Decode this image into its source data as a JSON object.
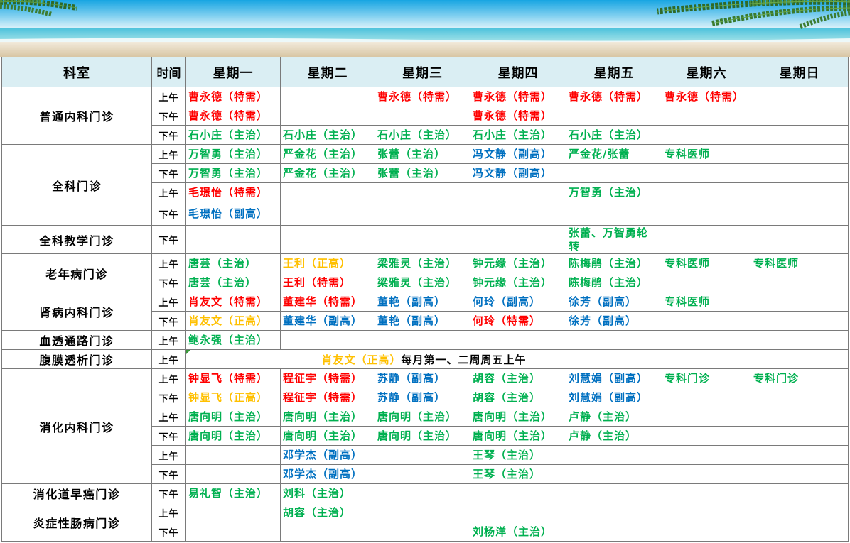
{
  "header": {
    "dept": "科室",
    "time": "时间",
    "days": [
      "星期一",
      "星期二",
      "星期三",
      "星期四",
      "星期五",
      "星期六",
      "星期日"
    ]
  },
  "header_background": "#daeef3",
  "palette": {
    "red": "#ff0000",
    "green": "#00b050",
    "blue": "#0070c0",
    "orange": "#ffc000",
    "black": "#000000"
  },
  "departments": [
    {
      "name": "普通内科门诊",
      "slots": [
        {
          "time": "上午",
          "cells": [
            {
              "text": "曹永德（特需）",
              "color": "red"
            },
            null,
            {
              "text": "曹永德（特需）",
              "color": "red"
            },
            {
              "text": "曹永德（特需）",
              "color": "red"
            },
            {
              "text": "曹永德（特需）",
              "color": "red"
            },
            {
              "text": "曹永德（特需）",
              "color": "red"
            },
            null
          ]
        },
        {
          "time": "下午",
          "cells": [
            {
              "text": "曹永德（特需）",
              "color": "red"
            },
            null,
            null,
            {
              "text": "曹永德（特需）",
              "color": "red"
            },
            null,
            null,
            null
          ]
        },
        {
          "time": "下午",
          "cells": [
            {
              "text": "石小庄（主治）",
              "color": "green"
            },
            {
              "text": "石小庄（主治）",
              "color": "green"
            },
            {
              "text": "石小庄（主治）",
              "color": "green"
            },
            {
              "text": "石小庄（主治）",
              "color": "green"
            },
            {
              "text": "石小庄（主治）",
              "color": "green"
            },
            null,
            null
          ]
        }
      ]
    },
    {
      "name": "全科门诊",
      "slots": [
        {
          "time": "上午",
          "cells": [
            {
              "text": "万智勇（主治）",
              "color": "green"
            },
            {
              "text": "严金花（主治）",
              "color": "green"
            },
            {
              "text": "张蕾（主治）",
              "color": "green"
            },
            {
              "text": "冯文静（副高）",
              "color": "blue"
            },
            {
              "text": "严金花/张蕾",
              "color": "green"
            },
            {
              "text": "专科医师",
              "color": "green"
            },
            null
          ]
        },
        {
          "time": "下午",
          "cells": [
            {
              "text": "万智勇（主治）",
              "color": "green"
            },
            {
              "text": "严金花（主治）",
              "color": "green"
            },
            {
              "text": "张蕾（主治）",
              "color": "green"
            },
            {
              "text": "冯文静（副高）",
              "color": "blue"
            },
            null,
            null,
            null
          ]
        },
        {
          "time": "上午",
          "cells": [
            {
              "text": "毛璟怡（特需）",
              "color": "red"
            },
            null,
            null,
            null,
            {
              "text": "万智勇（主治）",
              "color": "green"
            },
            null,
            null
          ]
        },
        {
          "time": "下午",
          "cells": [
            {
              "text": "毛璟怡（副高）",
              "color": "blue"
            },
            null,
            null,
            null,
            null,
            null,
            null
          ]
        }
      ]
    },
    {
      "name": "全科教学门诊",
      "slots": [
        {
          "time": "下午",
          "cells": [
            null,
            null,
            null,
            null,
            {
              "text": "张蕾、万智勇轮转",
              "color": "green"
            },
            null,
            null
          ]
        }
      ]
    },
    {
      "name": "老年病门诊",
      "slots": [
        {
          "time": "上午",
          "cells": [
            {
              "text": "唐芸（主治）",
              "color": "green"
            },
            {
              "text": "王利（正高）",
              "color": "orange"
            },
            {
              "text": "梁雅灵（主治）",
              "color": "green"
            },
            {
              "text": "钟元缘（主治）",
              "color": "green"
            },
            {
              "text": "陈梅鹃（主治）",
              "color": "green"
            },
            {
              "text": "专科医师",
              "color": "green"
            },
            {
              "text": "专科医师",
              "color": "green"
            }
          ]
        },
        {
          "time": "下午",
          "cells": [
            {
              "text": "唐芸（主治）",
              "color": "green"
            },
            {
              "text": "王利（特需）",
              "color": "red"
            },
            {
              "text": "梁雅灵（主治）",
              "color": "green"
            },
            {
              "text": "钟元缘（主治）",
              "color": "green"
            },
            {
              "text": "陈梅鹃（主治）",
              "color": "green"
            },
            null,
            null
          ]
        }
      ]
    },
    {
      "name": "肾病内科门诊",
      "slots": [
        {
          "time": "上午",
          "cells": [
            {
              "text": "肖友文（特需）",
              "color": "red"
            },
            {
              "text": "董建华（特需）",
              "color": "red"
            },
            {
              "text": "董艳（副高）",
              "color": "blue"
            },
            {
              "text": "何玲（副高）",
              "color": "blue"
            },
            {
              "text": "徐芳（副高）",
              "color": "blue"
            },
            {
              "text": "专科医师",
              "color": "green"
            },
            null
          ]
        },
        {
          "time": "下午",
          "cells": [
            {
              "text": "肖友文（正高）",
              "color": "orange"
            },
            {
              "text": "董建华（副高）",
              "color": "blue"
            },
            {
              "text": "董艳（副高）",
              "color": "blue"
            },
            {
              "text": "何玲（特需）",
              "color": "red"
            },
            {
              "text": "徐芳（副高）",
              "color": "blue"
            },
            null,
            null
          ]
        }
      ]
    },
    {
      "name": "血透通路门诊",
      "slots": [
        {
          "time": "上午",
          "cells": [
            {
              "text": "鲍永强（主治）",
              "color": "green"
            },
            null,
            null,
            null,
            null,
            null,
            null
          ]
        }
      ]
    },
    {
      "name": "腹膜透析门诊",
      "slots": [
        {
          "time": "上午",
          "merged": [
            {
              "text": "肖友文（正高）",
              "color": "orange"
            },
            {
              "text": "每月第一、二周周五上午",
              "color": "black"
            }
          ],
          "cells": [
            null,
            null
          ]
        }
      ]
    },
    {
      "name": "消化内科门诊",
      "slots": [
        {
          "time": "上午",
          "cells": [
            {
              "text": "钟显飞（特需）",
              "color": "red"
            },
            {
              "text": "程征宇（特需）",
              "color": "red"
            },
            {
              "text": "苏静（副高）",
              "color": "blue"
            },
            {
              "text": "胡容（主治）",
              "color": "green"
            },
            {
              "text": "刘慧娟（副高）",
              "color": "blue"
            },
            {
              "text": "专科门诊",
              "color": "green"
            },
            {
              "text": "专科门诊",
              "color": "green"
            }
          ]
        },
        {
          "time": "下午",
          "cells": [
            {
              "text": "钟显飞（正高）",
              "color": "orange"
            },
            {
              "text": "程征宇（特需）",
              "color": "red"
            },
            {
              "text": "苏静（副高）",
              "color": "blue"
            },
            {
              "text": "胡容（主治）",
              "color": "green"
            },
            {
              "text": "刘慧娟（副高）",
              "color": "blue"
            },
            null,
            null
          ]
        },
        {
          "time": "上午",
          "cells": [
            {
              "text": "唐向明（主治）",
              "color": "green"
            },
            {
              "text": "唐向明（主治）",
              "color": "green"
            },
            {
              "text": "唐向明（主治）",
              "color": "green"
            },
            {
              "text": "唐向明（主治）",
              "color": "green"
            },
            {
              "text": "卢静（主治）",
              "color": "green"
            },
            null,
            null
          ]
        },
        {
          "time": "下午",
          "cells": [
            {
              "text": "唐向明（主治）",
              "color": "green"
            },
            {
              "text": "唐向明（主治）",
              "color": "green"
            },
            {
              "text": "唐向明（主治）",
              "color": "green"
            },
            {
              "text": "唐向明（主治）",
              "color": "green"
            },
            {
              "text": "卢静（主治）",
              "color": "green"
            },
            null,
            null
          ]
        },
        {
          "time": "上午",
          "cells": [
            null,
            {
              "text": "邓学杰（副高）",
              "color": "blue"
            },
            null,
            {
              "text": "王琴（主治）",
              "color": "green"
            },
            null,
            null,
            null
          ]
        },
        {
          "time": "下午",
          "cells": [
            null,
            {
              "text": "邓学杰（副高）",
              "color": "blue"
            },
            null,
            {
              "text": "王琴（主治）",
              "color": "green"
            },
            null,
            null,
            null
          ]
        }
      ]
    },
    {
      "name": "消化道早癌门诊",
      "slots": [
        {
          "time": "下午",
          "cells": [
            {
              "text": "易礼智（主治）",
              "color": "green"
            },
            {
              "text": "刘科（主治）",
              "color": "green"
            },
            null,
            null,
            null,
            null,
            null
          ]
        }
      ]
    },
    {
      "name": "炎症性肠病门诊",
      "slots": [
        {
          "time": "上午",
          "cells": [
            null,
            {
              "text": "胡容（主治）",
              "color": "green"
            },
            null,
            null,
            null,
            null,
            null
          ]
        },
        {
          "time": "下午",
          "cells": [
            null,
            null,
            null,
            {
              "text": "刘杨洋（主治）",
              "color": "green"
            },
            null,
            null,
            null
          ]
        }
      ]
    }
  ]
}
